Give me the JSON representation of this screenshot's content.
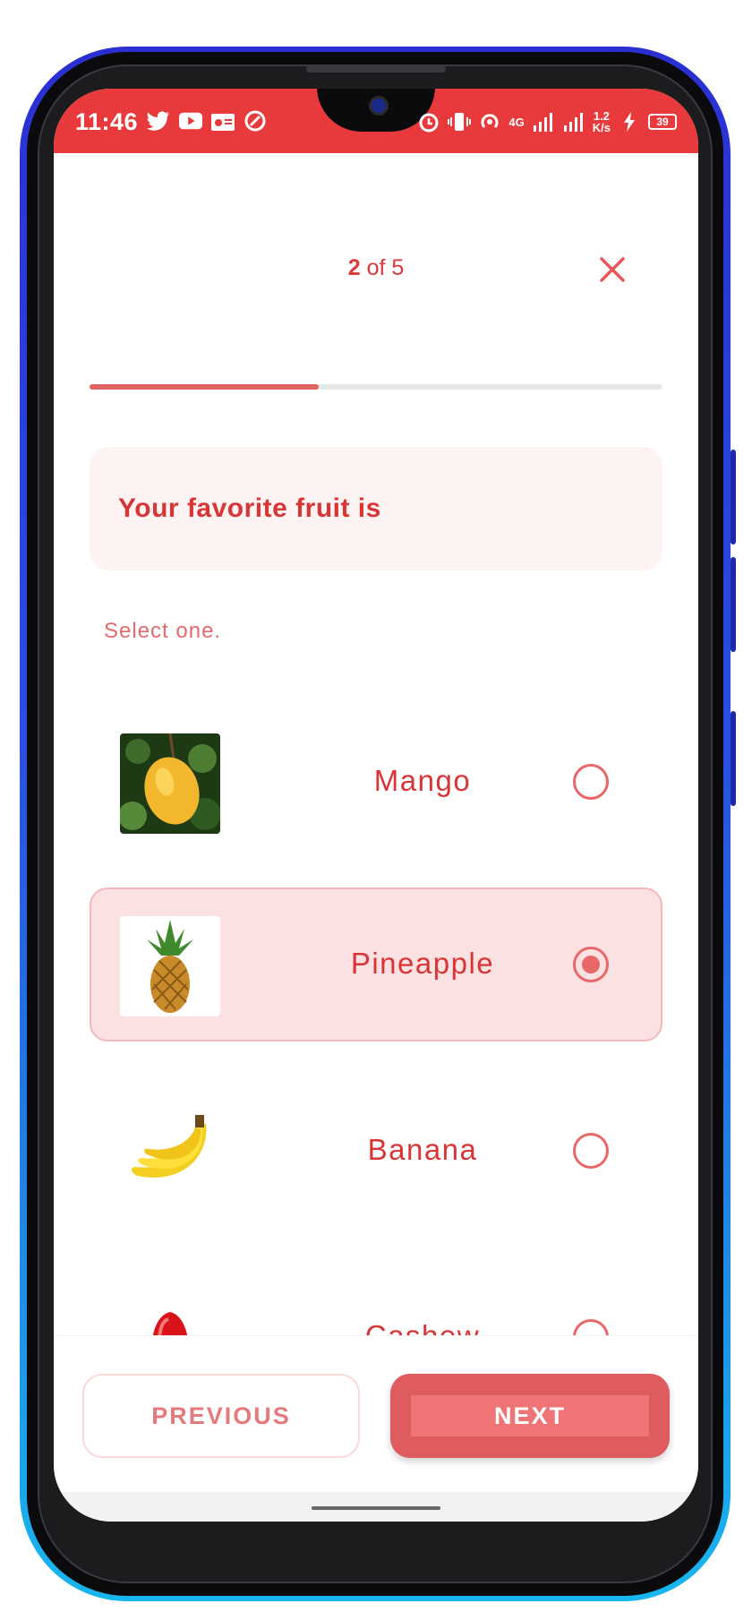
{
  "status_bar": {
    "time": "11:46",
    "network_speed_value": "1.2",
    "network_speed_unit": "K/s",
    "network_type": "4G",
    "battery": "39",
    "icons_left": [
      "twitter-icon",
      "youtube-icon",
      "radio-icon",
      "at-sign-icon"
    ],
    "icons_right": [
      "alarm-icon",
      "vibrate-icon",
      "hotspot-icon",
      "signal-icon",
      "signal-icon",
      "charging-icon",
      "battery-icon"
    ]
  },
  "header": {
    "step_current": "2",
    "step_rest": " of 5",
    "progress_fraction": 0.4
  },
  "question": {
    "text": "Your favorite fruit is",
    "hint": "Select one."
  },
  "options": [
    {
      "label": "Mango",
      "selected": false
    },
    {
      "label": "Pineapple",
      "selected": true
    },
    {
      "label": "Banana",
      "selected": false
    },
    {
      "label": "Cashew",
      "selected": false
    }
  ],
  "buttons": {
    "previous": "PREVIOUS",
    "next": "NEXT"
  },
  "colors": {
    "accent": "#e83a3c",
    "text_primary": "#d83537",
    "selected_bg": "#fbe1e1",
    "next_button": "#df5c5e"
  }
}
